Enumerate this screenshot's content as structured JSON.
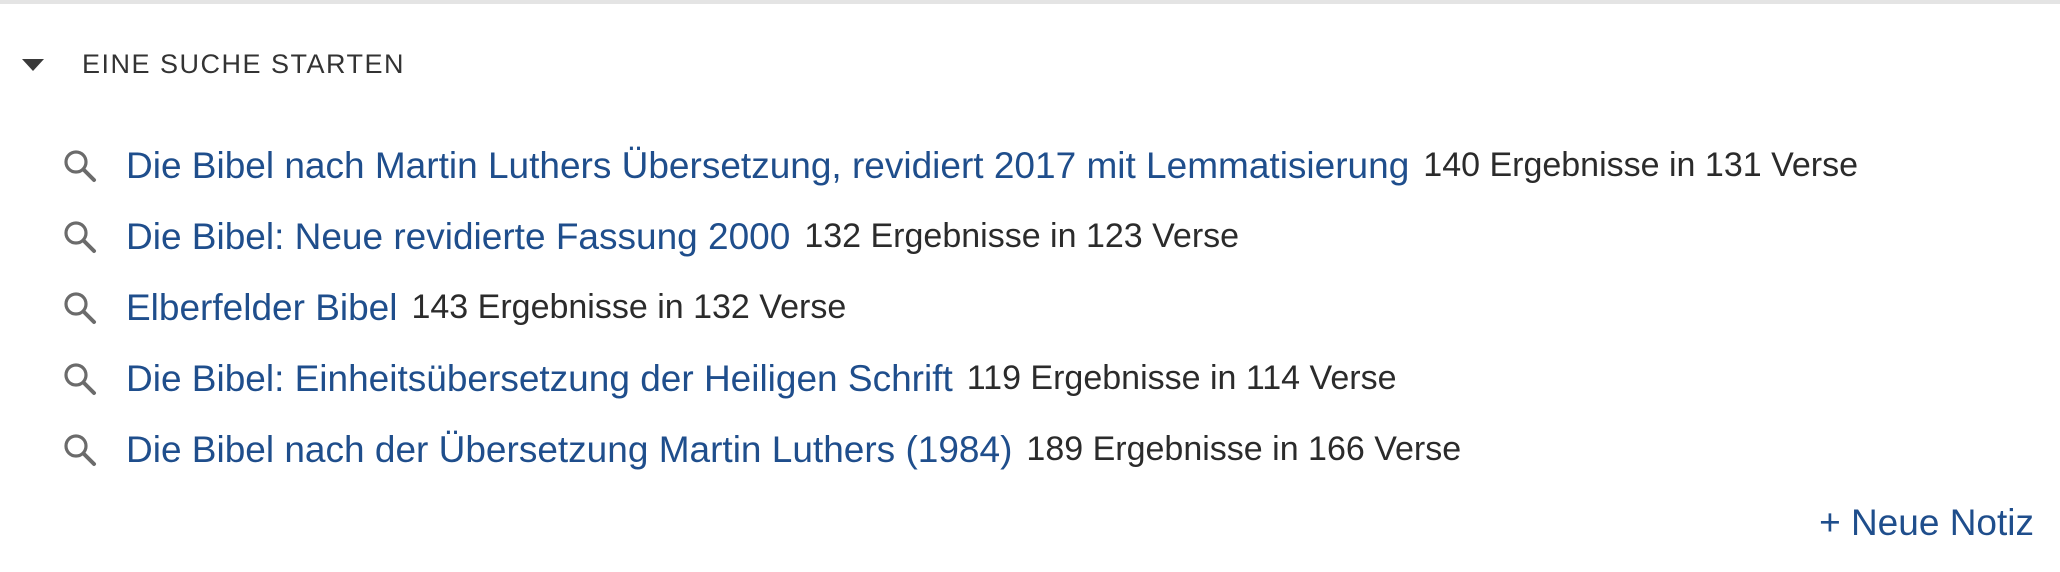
{
  "section": {
    "title": "EINE SUCHE STARTEN"
  },
  "colors": {
    "link": "#1f4e8c",
    "text": "#2b2b2b",
    "icon": "#6b6b6b"
  },
  "results": [
    {
      "icon": "search-icon",
      "label": "Die Bibel nach Martin Luthers Übersetzung, revidiert 2017 mit Lemmatisierung",
      "count": "140 Ergebnisse in 131 Verse"
    },
    {
      "icon": "search-icon",
      "label": "Die Bibel: Neue revidierte Fassung 2000",
      "count": "132 Ergebnisse in 123 Verse"
    },
    {
      "icon": "search-icon",
      "label": "Elberfelder Bibel",
      "count": "143 Ergebnisse in 132 Verse"
    },
    {
      "icon": "search-icon",
      "label": "Die Bibel: Einheitsübersetzung der Heiligen Schrift",
      "count": "119 Ergebnisse in 114 Verse"
    },
    {
      "icon": "search-icon",
      "label": "Die Bibel nach der Übersetzung Martin Luthers (1984)",
      "count": "189 Ergebnisse in 166 Verse"
    }
  ],
  "actions": {
    "new_note_label": "+ Neue Notiz"
  }
}
